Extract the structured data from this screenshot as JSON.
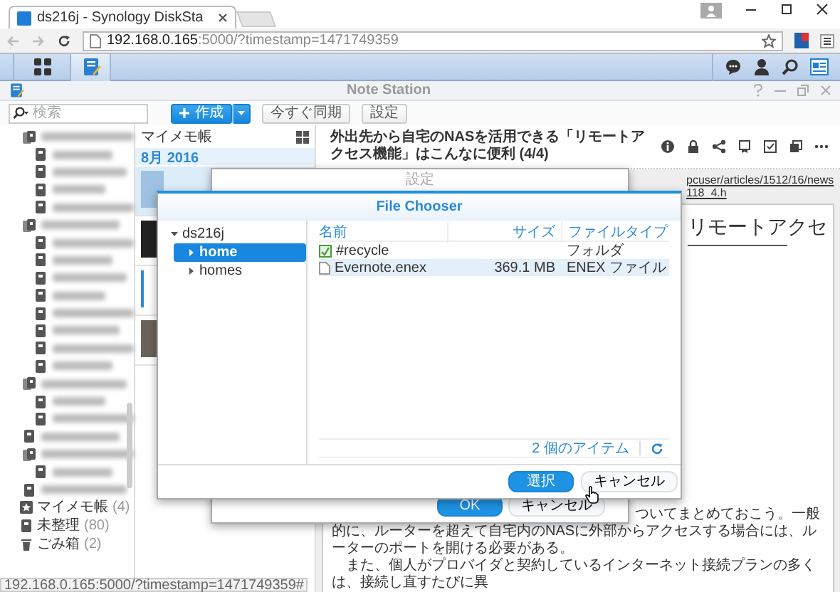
{
  "browser": {
    "tab_title": "ds216j - Synology DiskSta",
    "url_host": "192.168.0.165",
    "url_rest": ":5000/?timestamp=1471749359"
  },
  "taskbar": {
    "apps": [
      {
        "kind": "main-menu",
        "selected": false
      },
      {
        "kind": "note-station",
        "selected": true
      }
    ]
  },
  "window": {
    "title": "Note Station"
  },
  "toolbar": {
    "search_placeholder": "検索",
    "create": "作成",
    "sync": "今すぐ同期",
    "settings": "設定"
  },
  "sidebar": {
    "notebooks": [
      {
        "kind": "stack",
        "children": [
          {
            "kind": "note"
          },
          {
            "kind": "note"
          },
          {
            "kind": "note"
          },
          {
            "kind": "note"
          }
        ]
      },
      {
        "kind": "stack",
        "children": [
          {
            "kind": "note"
          },
          {
            "kind": "note"
          },
          {
            "kind": "note"
          },
          {
            "kind": "note"
          },
          {
            "kind": "note"
          },
          {
            "kind": "note"
          },
          {
            "kind": "note"
          },
          {
            "kind": "note"
          }
        ]
      },
      {
        "kind": "stack",
        "children": [
          {
            "kind": "note"
          },
          {
            "kind": "note"
          }
        ]
      },
      {
        "kind": "note"
      },
      {
        "kind": "stack",
        "children": [
          {
            "kind": "note"
          }
        ]
      },
      {
        "kind": "note"
      }
    ],
    "special": [
      {
        "kind": "shortcut",
        "label": "マイメモ帳",
        "count": "(4)"
      },
      {
        "kind": "uncategorized",
        "label": "未整理",
        "count": "(80)"
      },
      {
        "kind": "trash",
        "label": "ごみ箱",
        "count": "(2)"
      }
    ]
  },
  "note_list": {
    "title": "マイメモ帳",
    "group": "8月 2016",
    "notes": [
      {
        "kind": "screenshot",
        "selected": true
      },
      {
        "kind": "dark",
        "selected": false
      },
      {
        "kind": "text",
        "selected": false
      },
      {
        "kind": "photo",
        "selected": false
      }
    ]
  },
  "note": {
    "title": "外出先から自宅のNASを活用できる「リモートアクセス機能」はこんなに便利 (4/4)",
    "link": "pcuser/articles/1512/16/news118_4.h",
    "heading": "リモートアクセ",
    "paragraphs": [
      "ついてまとめておこう。一般的に、ルーターを超えて自宅内のNASに外部からアクセスする場合には、ルーターのポートを開ける必要がある。",
      "　また、個人がプロバイダと契約しているインターネット接続プランの多くは、接続し直すたびに異"
    ]
  },
  "settings_dialog": {
    "title": "設定",
    "buttons": [
      {
        "label": "OK",
        "kind": "primary"
      },
      {
        "label": "キャンセル",
        "kind": "secondary"
      }
    ]
  },
  "file_chooser": {
    "title": "File Chooser",
    "tree": [
      {
        "label": "ds216j",
        "expanded": true,
        "selected": false,
        "children": [
          {
            "label": "home",
            "expanded": false,
            "selected": true
          },
          {
            "label": "homes",
            "expanded": false,
            "selected": false
          }
        ]
      }
    ],
    "columns": [
      "名前",
      "サイズ",
      "ファイルタイプ"
    ],
    "rows": [
      {
        "kind": "folder",
        "name": "#recycle",
        "type": "フォルダ",
        "selected": false
      },
      {
        "kind": "file",
        "name": "Evernote.enex",
        "size": "369.1 MB",
        "type": "ENEX ファイル",
        "selected": true
      }
    ],
    "item_count": "2 個のアイテム",
    "buttons": [
      {
        "label": "選択",
        "kind": "primary"
      },
      {
        "label": "キャンセル",
        "kind": "secondary"
      }
    ]
  },
  "status_bar": "192.168.0.165:5000/?timestamp=1471749359#"
}
